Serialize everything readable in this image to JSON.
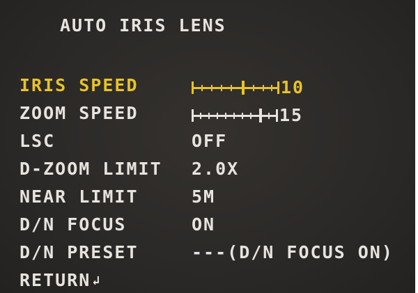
{
  "menu": {
    "title": "AUTO IRIS LENS",
    "items": [
      {
        "label": "IRIS SPEED",
        "kind": "slider",
        "value": "10",
        "position": 0.6,
        "selected": true
      },
      {
        "label": "ZOOM SPEED",
        "kind": "slider",
        "value": "15",
        "position": 0.85,
        "selected": false
      },
      {
        "label": "LSC",
        "kind": "text",
        "value": "OFF"
      },
      {
        "label": "D-ZOOM LIMIT",
        "kind": "text",
        "value": "2.0X"
      },
      {
        "label": "NEAR LIMIT",
        "kind": "text",
        "value": "5M"
      },
      {
        "label": "D/N FOCUS",
        "kind": "text",
        "value": "ON"
      },
      {
        "label": "D/N PRESET",
        "kind": "text",
        "value": "---(D/N FOCUS ON)"
      }
    ],
    "return_label": "RETURN",
    "return_icon": "return-arrow-icon"
  },
  "colors": {
    "background": "#2b2927",
    "text": "#e7e4df",
    "highlight": "#e8c328"
  }
}
